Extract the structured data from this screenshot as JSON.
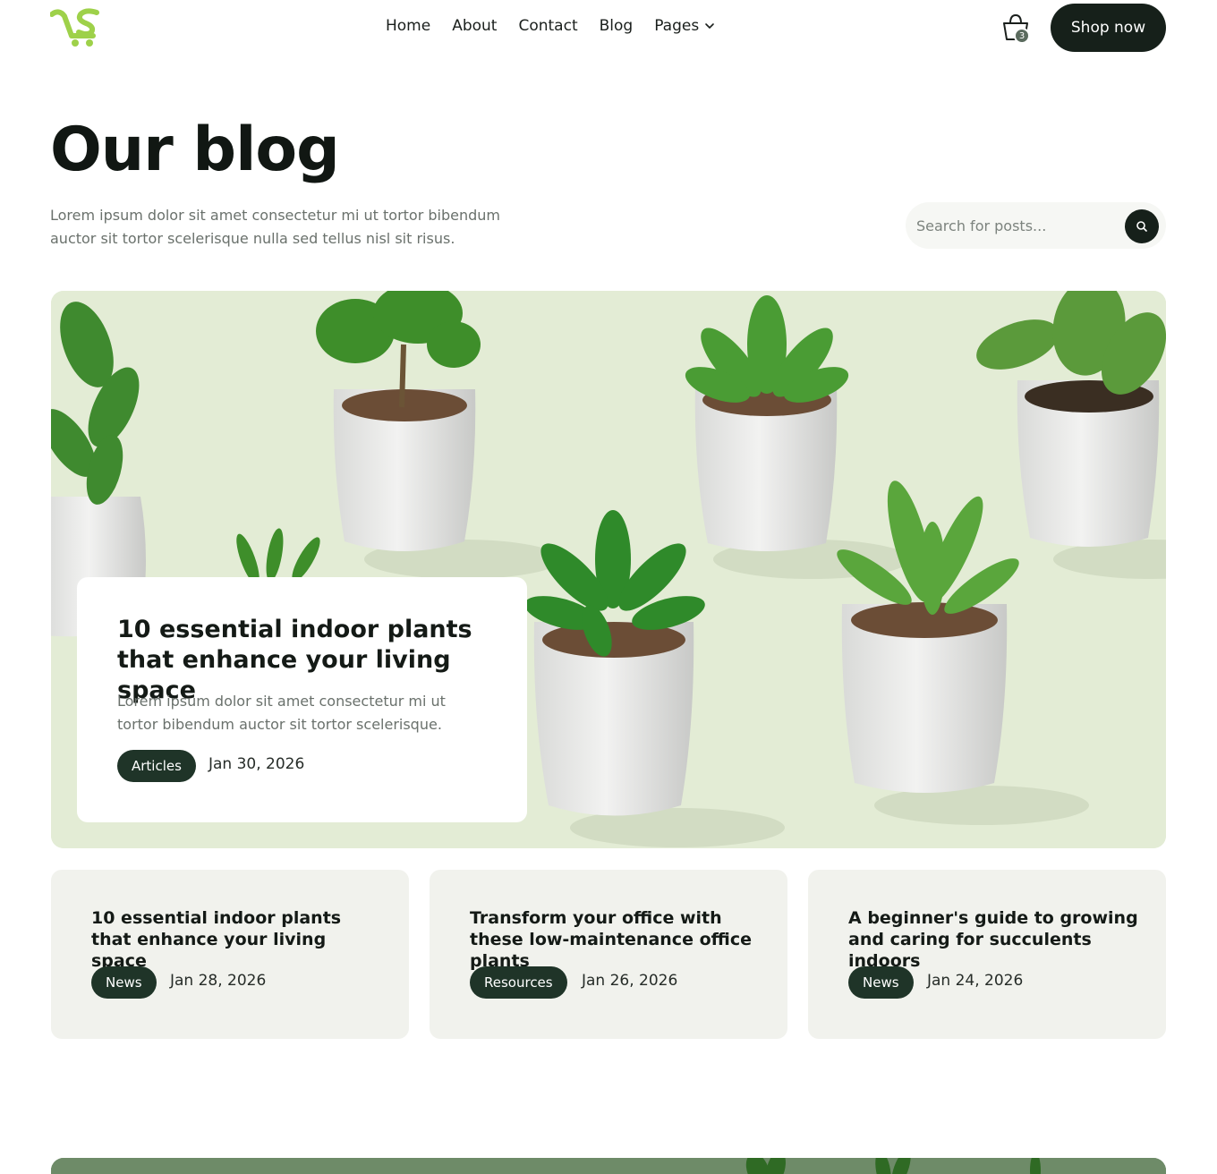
{
  "brand": {
    "accent": "#9ed14a",
    "dark": "#16201a",
    "pill": "#1f3428"
  },
  "nav": {
    "items": [
      {
        "label": "Home"
      },
      {
        "label": "About"
      },
      {
        "label": "Contact"
      },
      {
        "label": "Blog"
      },
      {
        "label": "Pages"
      }
    ],
    "cart_count": "3",
    "cta_label": "Shop now"
  },
  "hero": {
    "title": "Our blog",
    "description": "Lorem ipsum dolor sit amet consectetur mi ut tortor bibendum auctor sit tortor scelerisque nulla sed tellus nisl sit risus.",
    "search_placeholder": "Search for posts..."
  },
  "featured": {
    "title": "10 essential indoor plants that enhance your living space",
    "excerpt": "Lorem ipsum dolor sit amet consectetur mi ut tortor bibendum auctor sit tortor scelerisque.",
    "tag": "Articles",
    "date": "Jan 30, 2026"
  },
  "posts": [
    {
      "title": "10 essential indoor plants that enhance your living space",
      "tag": "News",
      "date": "Jan 28, 2026"
    },
    {
      "title": "Transform your office with these low-maintenance office plants",
      "tag": "Resources",
      "date": "Jan 26, 2026"
    },
    {
      "title": "A beginner's  guide to growing and caring for succulents indoors",
      "tag": "News",
      "date": "Jan 24, 2026"
    }
  ],
  "icons": [
    "logo-cart-icon",
    "chevron-down-icon",
    "shopping-bag-icon",
    "search-icon"
  ]
}
